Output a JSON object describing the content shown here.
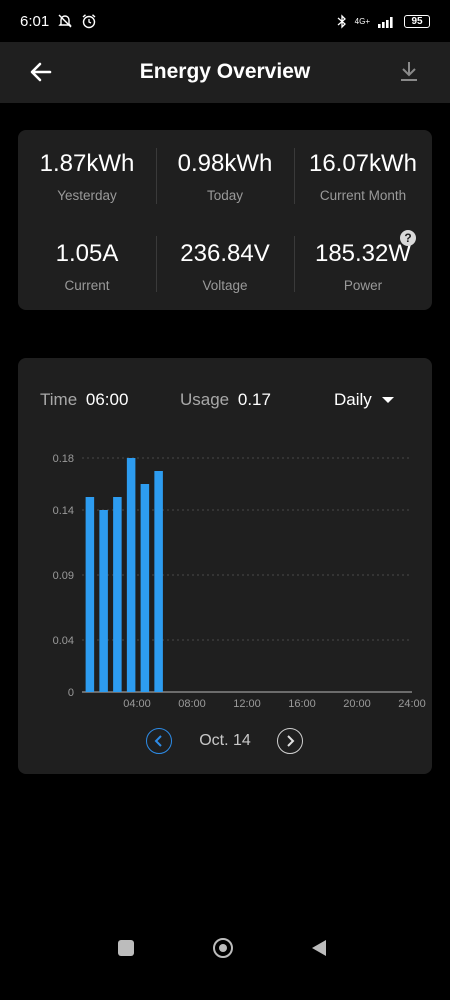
{
  "status": {
    "time": "6:01",
    "network": "4G+",
    "battery": "95"
  },
  "header": {
    "title": "Energy Overview"
  },
  "stats": [
    {
      "value": "1.87kWh",
      "label": "Yesterday"
    },
    {
      "value": "0.98kWh",
      "label": "Today"
    },
    {
      "value": "16.07kWh",
      "label": "Current Month"
    },
    {
      "value": "1.05A",
      "label": "Current"
    },
    {
      "value": "236.84V",
      "label": "Voltage"
    },
    {
      "value": "185.32W",
      "label": "Power"
    }
  ],
  "help_glyph": "?",
  "chart_header": {
    "time_label": "Time",
    "time_value": "06:00",
    "usage_label": "Usage",
    "usage_value": "0.17",
    "period": "Daily"
  },
  "chart_data": {
    "type": "bar",
    "color": "#2d9cf0",
    "y_ticks": [
      "0.18",
      "0.14",
      "0.09",
      "0.04",
      "0"
    ],
    "y_tick_values": [
      0.18,
      0.14,
      0.09,
      0.04,
      0
    ],
    "x_ticks": [
      "04:00",
      "08:00",
      "12:00",
      "16:00",
      "20:00",
      "24:00"
    ],
    "x_tick_hours": [
      4,
      8,
      12,
      16,
      20,
      24
    ],
    "hours": [
      1,
      2,
      3,
      4,
      5,
      6
    ],
    "values": [
      0.15,
      0.14,
      0.15,
      0.18,
      0.16,
      0.17
    ],
    "ylim": [
      0,
      0.18
    ],
    "xlim": [
      0,
      24
    ]
  },
  "date_nav": {
    "date": "Oct. 14"
  },
  "colors": {
    "accent": "#2d8be6",
    "card": "#1f1f1f",
    "muted": "#9a9a9a"
  }
}
